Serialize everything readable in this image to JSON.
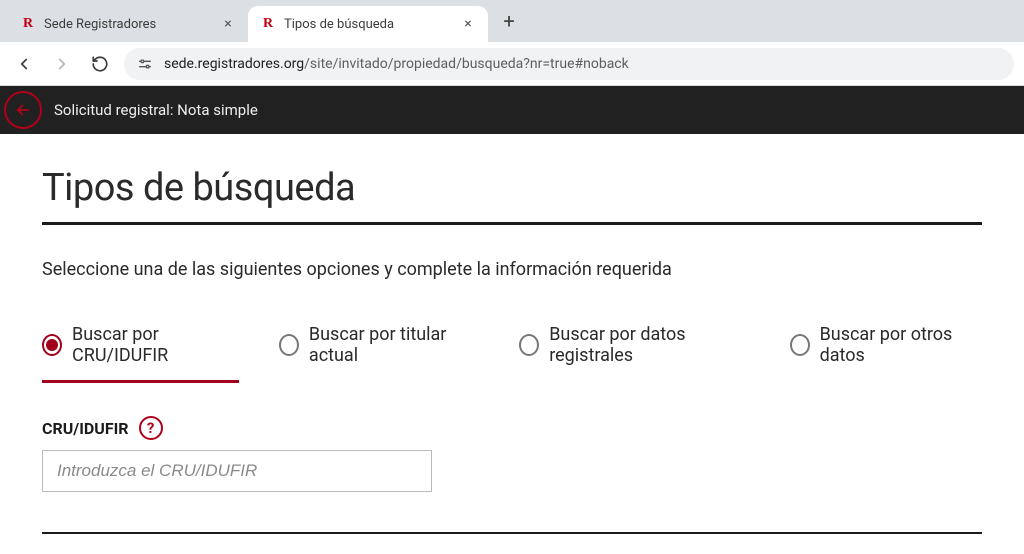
{
  "browser": {
    "tabs": [
      {
        "title": "Sede Registradores",
        "active": false
      },
      {
        "title": "Tipos de búsqueda",
        "active": true
      }
    ],
    "url_host": "sede.registradores.org",
    "url_path": "/site/invitado/propiedad/busqueda?nr=true#noback"
  },
  "topbar": {
    "breadcrumb": "Solicitud registral: Nota simple"
  },
  "page": {
    "title": "Tipos de búsqueda",
    "instruction": "Seleccione una de las siguientes opciones y complete la información requerida",
    "radios": [
      {
        "label": "Buscar por CRU/IDUFIR",
        "selected": true
      },
      {
        "label": "Buscar por titular actual",
        "selected": false
      },
      {
        "label": "Buscar por datos registrales",
        "selected": false
      },
      {
        "label": "Buscar por otros datos",
        "selected": false
      }
    ],
    "field": {
      "label": "CRU/IDUFIR",
      "help": "?",
      "placeholder": "Introduzca el CRU/IDUFIR",
      "value": ""
    }
  }
}
